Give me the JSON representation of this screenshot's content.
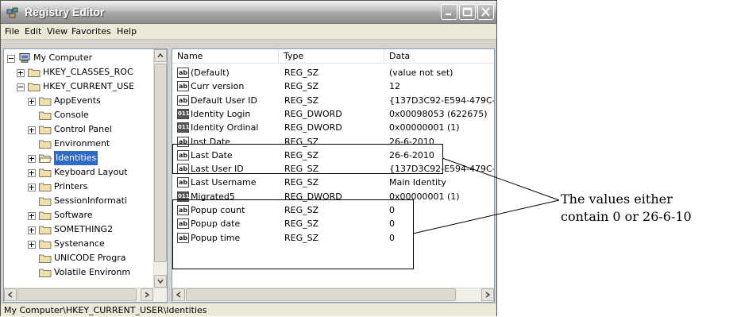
{
  "window": {
    "title": "Registry Editor",
    "buttons": [
      "minimize-icon",
      "maximize-icon",
      "close-icon"
    ]
  },
  "menu": [
    "File",
    "Edit",
    "View",
    "Favorites",
    "Help"
  ],
  "tree": [
    {
      "label": "My Computer",
      "expander": "minus",
      "icon": "computer-icon"
    },
    {
      "label": "HKEY_CLASSES_ROC",
      "expander": "plus",
      "icon": "folder-icon"
    },
    {
      "label": "HKEY_CURRENT_USE",
      "expander": "minus",
      "icon": "folder-icon"
    },
    {
      "label": "AppEvents",
      "expander": "plus",
      "icon": "folder-icon"
    },
    {
      "label": "Console",
      "expander": "none",
      "icon": "folder-icon"
    },
    {
      "label": "Control Panel",
      "expander": "plus",
      "icon": "folder-icon"
    },
    {
      "label": "Environment",
      "expander": "none",
      "icon": "folder-icon"
    },
    {
      "label": "Identities",
      "expander": "plus",
      "icon": "folder-open-icon",
      "selected": true
    },
    {
      "label": "Keyboard Layout",
      "expander": "plus",
      "icon": "folder-icon"
    },
    {
      "label": "Printers",
      "expander": "plus",
      "icon": "folder-icon"
    },
    {
      "label": "SessionInformati",
      "expander": "none",
      "icon": "folder-icon"
    },
    {
      "label": "Software",
      "expander": "plus",
      "icon": "folder-icon"
    },
    {
      "label": "SOMETHING2",
      "expander": "plus",
      "icon": "folder-icon"
    },
    {
      "label": "Systenance",
      "expander": "plus",
      "icon": "folder-icon"
    },
    {
      "label": "UNICODE Progra",
      "expander": "none",
      "icon": "folder-icon"
    },
    {
      "label": "Volatile Environm",
      "expander": "none",
      "icon": "folder-icon"
    }
  ],
  "list": {
    "columns": [
      "Name",
      "Type",
      "Data"
    ],
    "rows": [
      {
        "name": "(Default)",
        "type": "REG_SZ",
        "data": "(value not set)",
        "icon": "string-value-icon"
      },
      {
        "name": "Curr version",
        "type": "REG_SZ",
        "data": "12",
        "icon": "string-value-icon"
      },
      {
        "name": "Default User ID",
        "type": "REG_SZ",
        "data": "{137D3C92-E594-479C-",
        "icon": "string-value-icon"
      },
      {
        "name": "Identity Login",
        "type": "REG_DWORD",
        "data": "0x00098053 (622675)",
        "icon": "binary-value-icon"
      },
      {
        "name": "Identity Ordinal",
        "type": "REG_DWORD",
        "data": "0x00000001 (1)",
        "icon": "binary-value-icon"
      },
      {
        "name": "Inst Date",
        "type": "REG_SZ",
        "data": "26-6-2010",
        "icon": "string-value-icon"
      },
      {
        "name": "Last Date",
        "type": "REG_SZ",
        "data": "26-6-2010",
        "icon": "string-value-icon"
      },
      {
        "name": "Last User ID",
        "type": "REG_SZ",
        "data": "{137D3C92-E594-479C-",
        "icon": "string-value-icon"
      },
      {
        "name": "Last Username",
        "type": "REG_SZ",
        "data": "Main Identity",
        "icon": "string-value-icon"
      },
      {
        "name": "Migrated5",
        "type": "REG_DWORD",
        "data": "0x00000001 (1)",
        "icon": "binary-value-icon"
      },
      {
        "name": "Popup count",
        "type": "REG_SZ",
        "data": "0",
        "icon": "string-value-icon"
      },
      {
        "name": "Popup date",
        "type": "REG_SZ",
        "data": "0",
        "icon": "string-value-icon"
      },
      {
        "name": "Popup time",
        "type": "REG_SZ",
        "data": "0",
        "icon": "string-value-icon"
      }
    ]
  },
  "status": "My Computer\\HKEY_CURRENT_USER\\Identities",
  "annotation": {
    "line1": "The values either",
    "line2": "contain 0 or 26-6-10"
  }
}
